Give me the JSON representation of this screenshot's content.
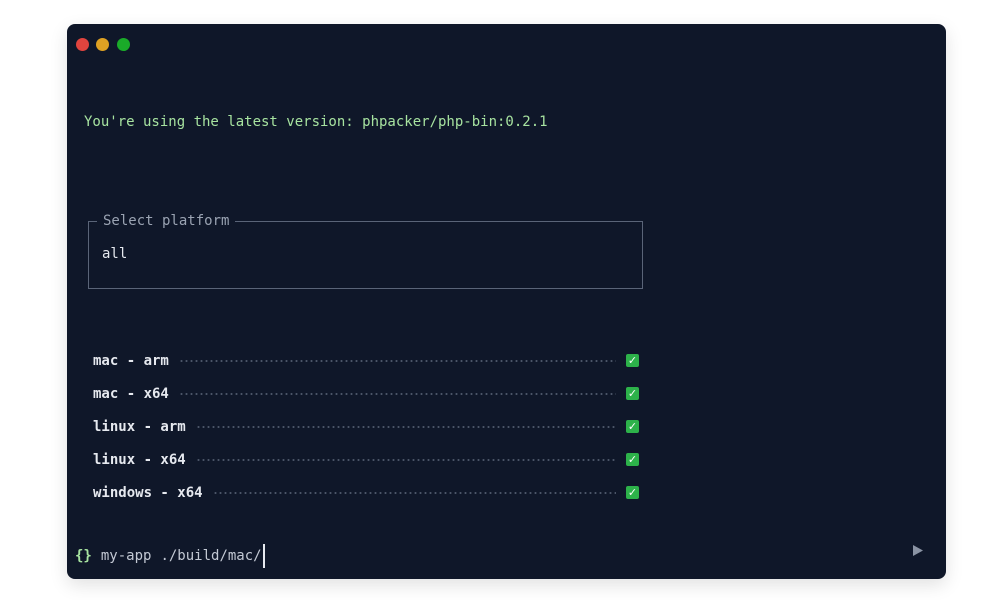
{
  "colors": {
    "window_bg": "#0f1729",
    "traffic_red": "#e0443e",
    "traffic_yellow": "#dea123",
    "traffic_green": "#1aab29",
    "accent_green": "#a7e3a0",
    "check_green": "#2db24a"
  },
  "terminal": {
    "version_line": "You're using the latest version: phpacker/php-bin:0.2.1",
    "select": {
      "legend": "Select platform",
      "value": "all"
    },
    "platforms": [
      {
        "label": "mac - arm",
        "status_icon": "check-icon"
      },
      {
        "label": "mac - x64",
        "status_icon": "check-icon"
      },
      {
        "label": "linux - arm",
        "status_icon": "check-icon"
      },
      {
        "label": "linux - x64",
        "status_icon": "check-icon"
      },
      {
        "label": "windows - x64",
        "status_icon": "check-icon"
      }
    ],
    "prompt": {
      "icon": "{}",
      "directory": "my-app",
      "command": "./build/mac/"
    }
  },
  "controls": {
    "play_icon": "play-icon"
  }
}
